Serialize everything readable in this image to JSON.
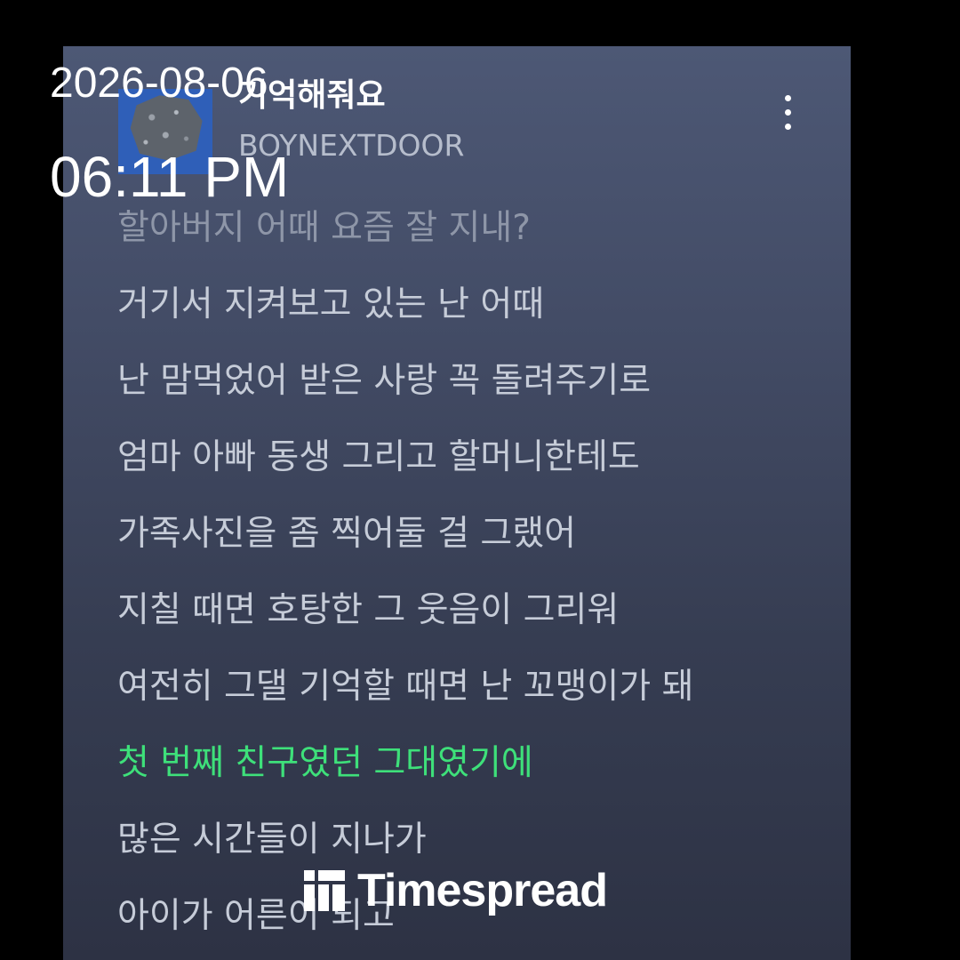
{
  "player": {
    "song_title": "기억해줘요",
    "artist": "BOYNEXTDOOR",
    "menu_icon": "more-vertical-icon",
    "album_art_color": "#2f5fb8"
  },
  "lyrics": [
    {
      "text": "할아버지 어때 요즘 잘 지내?",
      "state": "past"
    },
    {
      "text": "거기서 지켜보고 있는 난 어때",
      "state": "upcoming"
    },
    {
      "text": "난 맘먹었어 받은 사랑 꼭 돌려주기로",
      "state": "upcoming"
    },
    {
      "text": "엄마 아빠 동생 그리고 할머니한테도",
      "state": "upcoming"
    },
    {
      "text": "가족사진을 좀 찍어둘 걸 그랬어",
      "state": "upcoming"
    },
    {
      "text": "지칠 때면 호탕한 그 웃음이 그리워",
      "state": "upcoming"
    },
    {
      "text": "여전히 그댈 기억할 때면 난 꼬맹이가 돼",
      "state": "upcoming"
    },
    {
      "text": "첫 번째 친구였던 그대였기에",
      "state": "active"
    },
    {
      "text": "많은 시간들이 지나가",
      "state": "upcoming"
    },
    {
      "text": "아이가 어른이 되고",
      "state": "upcoming"
    }
  ],
  "overlay": {
    "date": "2026-08-06",
    "time": "06:11 PM"
  },
  "watermark": {
    "brand": "Timespread"
  },
  "colors": {
    "active_lyric": "#3ee07a",
    "lyric": "#c6ccd8",
    "background": "#000000"
  }
}
